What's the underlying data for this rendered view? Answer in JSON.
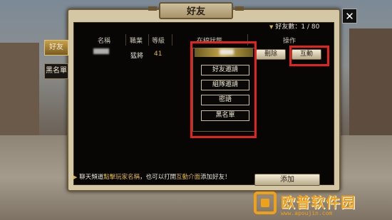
{
  "window": {
    "title": "好友",
    "close_label": "✕"
  },
  "friend_count": {
    "label": "好友數：1 / 80"
  },
  "side_tabs": [
    {
      "label": "好友",
      "active": true
    },
    {
      "label": "黑名單",
      "active": false
    }
  ],
  "table": {
    "headers": [
      "名稱",
      "職業",
      "等級",
      "在線狀態",
      "操作"
    ],
    "rows": [
      {
        "job": "猛將",
        "level": "41",
        "delete_label": "刪除",
        "interact_label": "互動"
      }
    ]
  },
  "interact_menu": {
    "items": [
      "好友邀請",
      "組隊邀請",
      "密語",
      "黑名單"
    ]
  },
  "tip": {
    "prefix": "聊天頻道",
    "link1": "點擊玩家名稱",
    "middle": "，也可以打開",
    "link2": "互動介面",
    "suffix": "添加好友！"
  },
  "add_button": {
    "label": "添加"
  },
  "watermark": {
    "title": "欧普软件园",
    "url": "www.apoujin.com"
  },
  "colors": {
    "highlight": "#e3231c",
    "accent_gold": "#c9a94c",
    "watermark": "#f0a11a"
  }
}
